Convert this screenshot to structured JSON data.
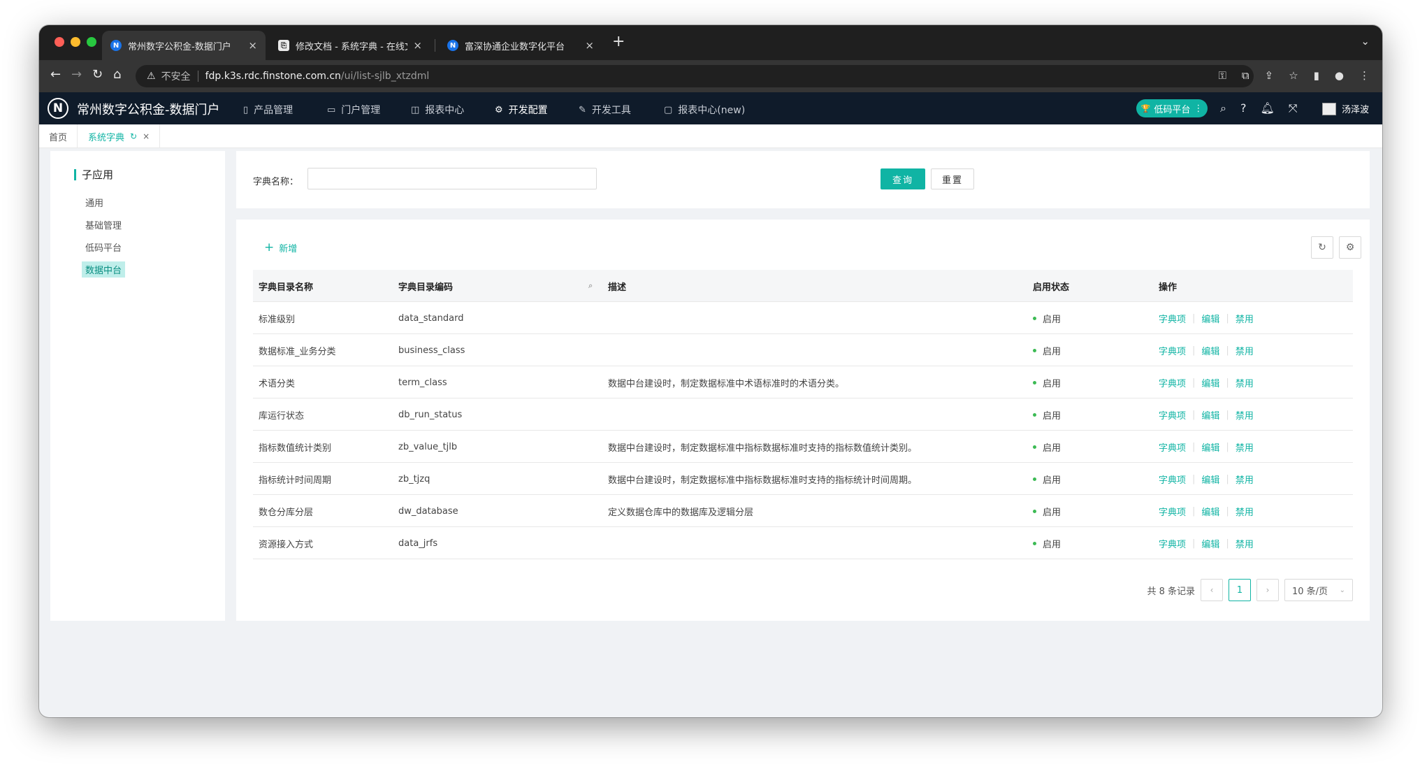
{
  "browser": {
    "tabs": [
      {
        "title": "常州数字公积金-数据门户",
        "icon": "N"
      },
      {
        "title": "修改文档 - 系统字典 - 在线文档",
        "icon": "⎘"
      },
      {
        "title": "富深协通企业数字化平台",
        "icon": "N"
      }
    ],
    "new_tab": "+",
    "address": {
      "insecure_label": "不安全",
      "host": "fdp.k3s.rdc.finstone.com.cn",
      "path": "/ui/list-sjlb_xtzdml"
    }
  },
  "app": {
    "logo": "N",
    "title": "常州数字公积金-数据门户",
    "menus": [
      {
        "label": "产品管理",
        "icon": "▯"
      },
      {
        "label": "门户管理",
        "icon": "▭"
      },
      {
        "label": "报表中心",
        "icon": "◫"
      },
      {
        "label": "开发配置",
        "icon": "⚙"
      },
      {
        "label": "开发工具",
        "icon": "✎"
      },
      {
        "label": "报表中心(new)",
        "icon": "▢"
      }
    ],
    "lowcode_label": "低码平台",
    "user_name": "汤泽波"
  },
  "page_tabs": [
    {
      "label": "首页"
    },
    {
      "label": "系统字典"
    }
  ],
  "sidebar": {
    "heading": "子应用",
    "items": [
      "通用",
      "基础管理",
      "低码平台",
      "数据中台"
    ]
  },
  "query": {
    "label": "字典名称：",
    "value": "",
    "search_btn": "查询",
    "reset_btn": "重置"
  },
  "list": {
    "add_label": "新增",
    "columns": [
      "字典目录名称",
      "字典目录编码",
      "描述",
      "启用状态",
      "操作"
    ],
    "actions": [
      "字典项",
      "编辑",
      "禁用"
    ],
    "rows": [
      {
        "name": "标准级别",
        "code": "data_standard",
        "desc": "",
        "status": "启用"
      },
      {
        "name": "数据标准_业务分类",
        "code": "business_class",
        "desc": "",
        "status": "启用"
      },
      {
        "name": "术语分类",
        "code": "term_class",
        "desc": "数据中台建设时，制定数据标准中术语标准时的术语分类。",
        "status": "启用"
      },
      {
        "name": "库运行状态",
        "code": "db_run_status",
        "desc": "",
        "status": "启用"
      },
      {
        "name": "指标数值统计类别",
        "code": "zb_value_tjlb",
        "desc": "数据中台建设时，制定数据标准中指标数据标准时支持的指标数值统计类别。",
        "status": "启用"
      },
      {
        "name": "指标统计时间周期",
        "code": "zb_tjzq",
        "desc": "数据中台建设时，制定数据标准中指标数据标准时支持的指标统计时间周期。",
        "status": "启用"
      },
      {
        "name": "数仓分库分层",
        "code": "dw_database",
        "desc": "定义数据仓库中的数据库及逻辑分层",
        "status": "启用"
      },
      {
        "name": "资源接入方式",
        "code": "data_jrfs",
        "desc": "",
        "status": "启用"
      }
    ]
  },
  "pager": {
    "total": "共 8 条记录",
    "prev": "‹",
    "current": "1",
    "next": "›",
    "page_size": "10 条/页"
  },
  "colors": {
    "accent": "#10b4a4",
    "header_bg": "#0f1b2a",
    "status_dot": "#3cba54"
  }
}
